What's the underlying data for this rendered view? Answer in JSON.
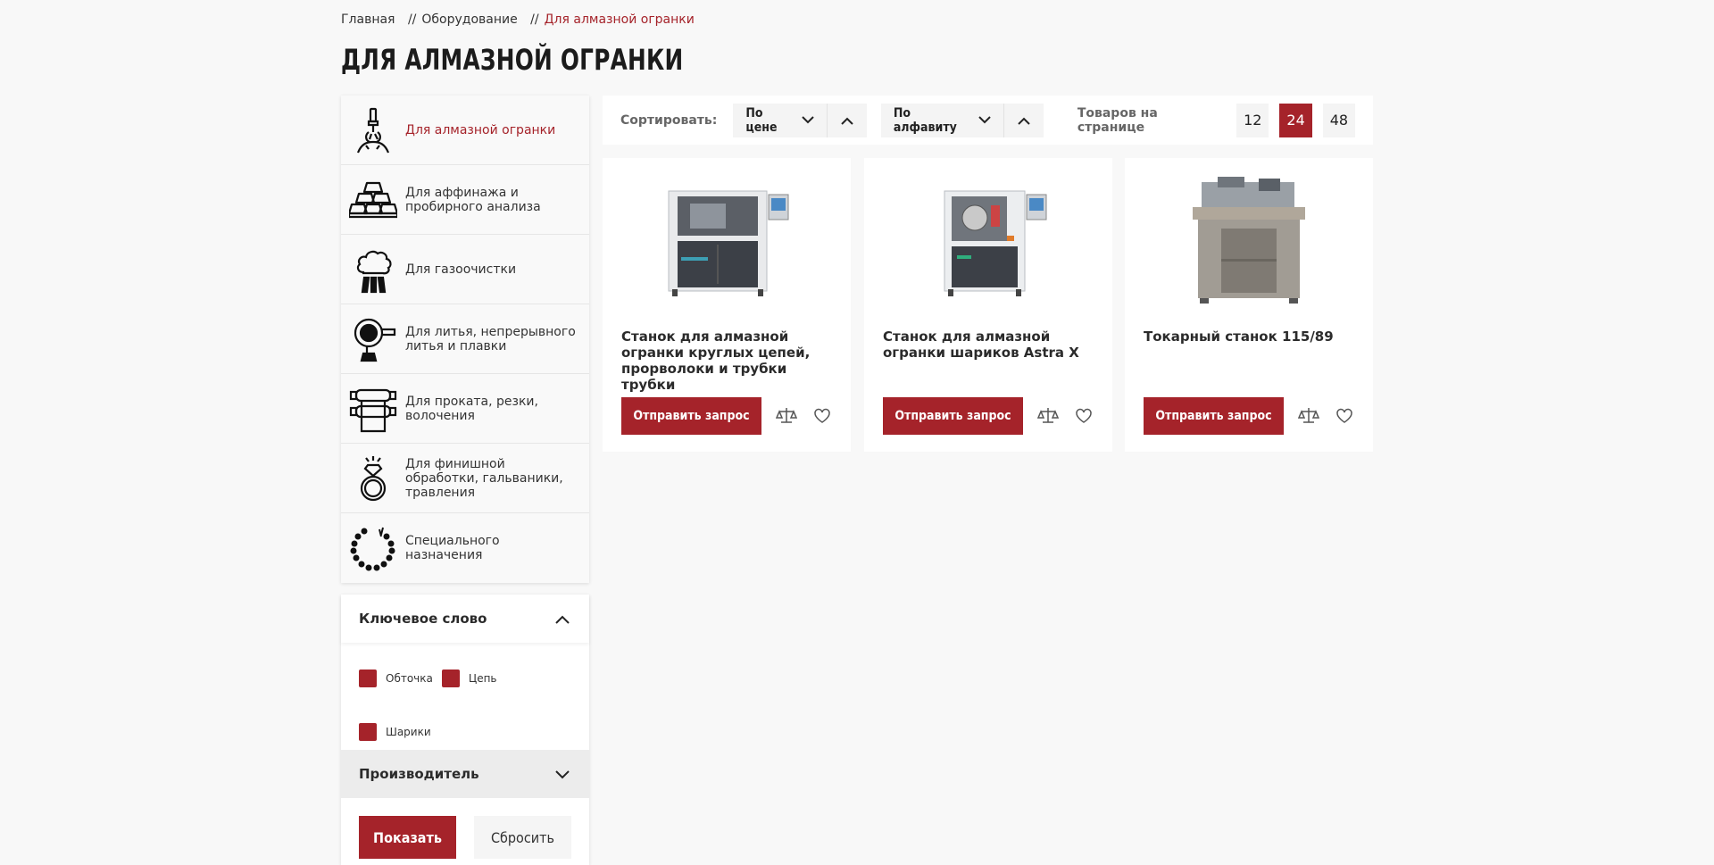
{
  "breadcrumb": {
    "items": [
      "Главная",
      "Оборудование",
      "Для алмазной огранки"
    ],
    "separator": "//"
  },
  "page_title": "ДЛЯ АЛМАЗНОЙ ОГРАНКИ",
  "categories": [
    {
      "label": "Для алмазной огранки",
      "icon": "diamond-cutting-icon",
      "active": true
    },
    {
      "label": "Для аффинажа и пробирного анализа",
      "icon": "gold-bars-icon",
      "active": false
    },
    {
      "label": "Для газоочистки",
      "icon": "gas-cleaning-icon",
      "active": false
    },
    {
      "label": "Для литья, непрерывного литья и плавки",
      "icon": "casting-icon",
      "active": false
    },
    {
      "label": "Для проката, резки, волочения",
      "icon": "rolling-icon",
      "active": false
    },
    {
      "label": "Для финишной обработки, гальваники, травления",
      "icon": "ring-icon",
      "active": false
    },
    {
      "label": "Специального назначения",
      "icon": "chain-icon",
      "active": false
    }
  ],
  "filter": {
    "keyword_title": "Ключевое слово",
    "keywords": [
      "Обточка",
      "Цепь",
      "Шарики"
    ],
    "maker_title": "Производитель",
    "show_label": "Показать",
    "reset_label": "Сбросить"
  },
  "sortbar": {
    "sort_label": "Сортировать:",
    "by_price": "По цене",
    "by_alpha": "По алфавиту",
    "per_page_label": "Товаров на странице",
    "per_page_options": [
      "12",
      "24",
      "48"
    ],
    "per_page_selected": "24"
  },
  "products": [
    {
      "name": "Станок для алмазной огранки круглых цепей, прорволоки и трубки трубки",
      "button": "Отправить запрос"
    },
    {
      "name": "Станок для алмазной огранки шариков Astra X",
      "button": "Отправить запрос"
    },
    {
      "name": "Токарный станок 115/89",
      "button": "Отправить запрос"
    }
  ],
  "colors": {
    "accent": "#a5232a",
    "background": "#f8f8f8"
  }
}
